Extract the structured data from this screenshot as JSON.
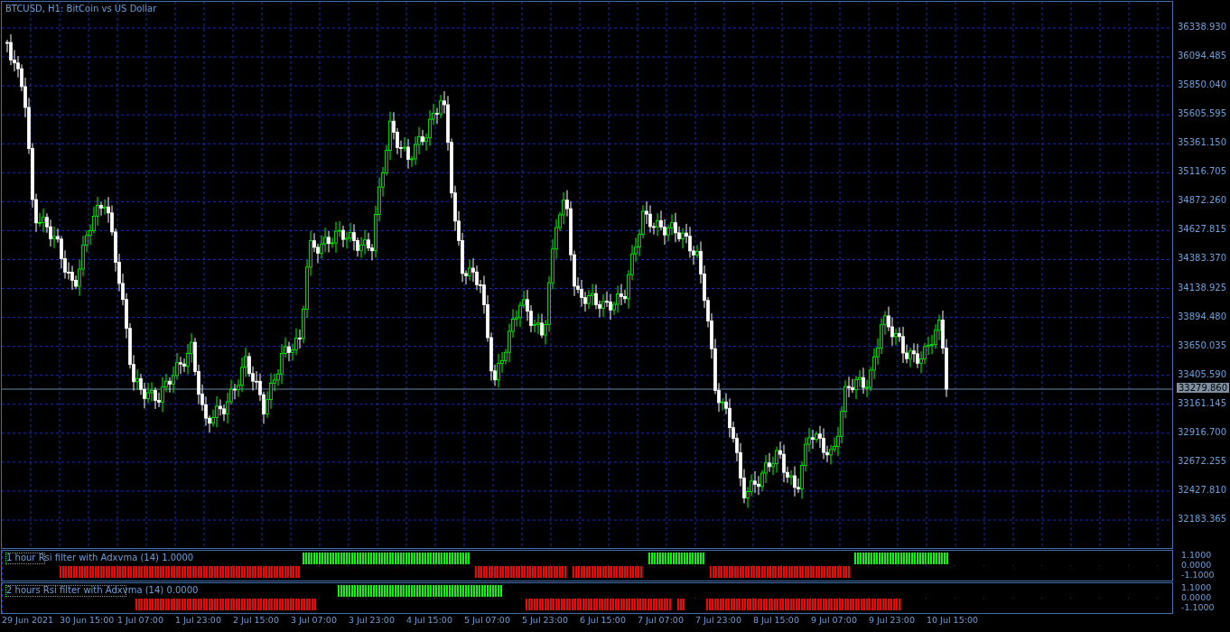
{
  "chart": {
    "title": "BTCUSD, H1:  BitCoin vs US Dollar"
  },
  "price_axis": [
    "36338.930",
    "36094.485",
    "35850.040",
    "35605.595",
    "35361.150",
    "35116.705",
    "34872.260",
    "34627.815",
    "34383.370",
    "34138.925",
    "33894.480",
    "33650.035",
    "33405.590",
    "33161.145",
    "32916.700",
    "32672.255",
    "32427.810",
    "32183.365"
  ],
  "current_price": "33279.860",
  "indicators": [
    {
      "label": "1 hour Rsi filter with Adxvma (14) 1.0000",
      "axis": [
        "1.1000",
        "0.0000",
        "-1.1000"
      ]
    },
    {
      "label": "2 hours Rsi filter with Adxvma (14) 0.0000",
      "axis": [
        "1.1000",
        "0.0000",
        "-1.1000"
      ]
    }
  ],
  "time_axis": [
    "29 Jun 2021",
    "30 Jun 15:00",
    "1 Jul 07:00",
    "1 Jul 23:00",
    "2 Jul 15:00",
    "3 Jul 07:00",
    "3 Jul 23:00",
    "4 Jul 15:00",
    "5 Jul 07:00",
    "5 Jul 23:00",
    "6 Jul 15:00",
    "7 Jul 07:00",
    "7 Jul 23:00",
    "8 Jul 15:00",
    "9 Jul 07:00",
    "9 Jul 23:00",
    "10 Jul 15:00"
  ]
}
